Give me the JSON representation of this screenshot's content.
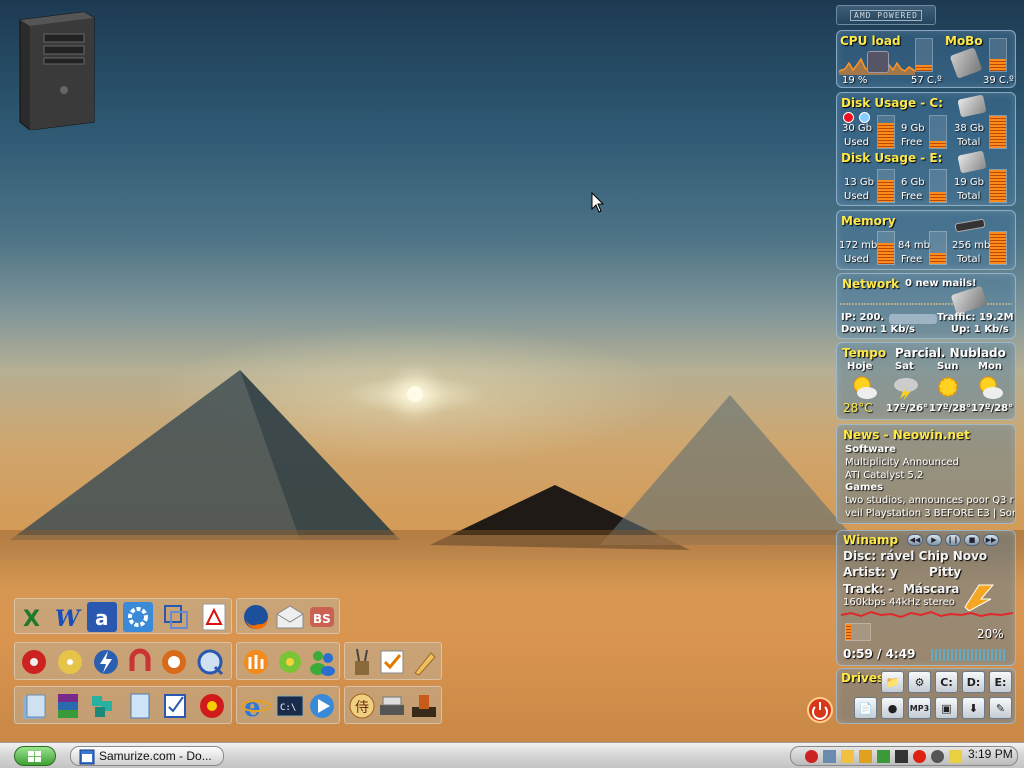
{
  "amd": {
    "label": "AMD POWERED"
  },
  "cpu": {
    "title": "CPU load",
    "load": "19 %",
    "temp": "57 C.º",
    "load_fraction": 0.19
  },
  "mobo": {
    "title": "MoBo",
    "temp": "39 C.º",
    "fraction": 0.39
  },
  "disk_c": {
    "title": "Disk Usage - C:",
    "used": "30 Gb",
    "used_label": "Used",
    "free": "9 Gb",
    "free_label": "Free",
    "total": "38 Gb",
    "total_label": "Total",
    "used_fraction": 0.79,
    "free_fraction": 0.21
  },
  "disk_e": {
    "title": "Disk Usage - E:",
    "used": "13 Gb",
    "used_label": "Used",
    "free": "6 Gb",
    "free_label": "Free",
    "total": "19 Gb",
    "total_label": "Total",
    "used_fraction": 0.68,
    "free_fraction": 0.32
  },
  "memory": {
    "title": "Memory",
    "used": "172 mb",
    "used_label": "Used",
    "free": "84 mb",
    "free_label": "Free",
    "total": "256 mb",
    "total_label": "Total",
    "used_fraction": 0.67,
    "free_fraction": 0.33
  },
  "network": {
    "title": "Network",
    "mails": "0 new mails!",
    "ip_label": "IP: 200.",
    "traffic": "Traffic: 19.2M",
    "down": "Down: 1 Kb/s",
    "up": "Up: 1 Kb/s"
  },
  "weather": {
    "title": "Tempo",
    "condition": "Parcial. Nublado",
    "days": [
      {
        "name": "Hoje",
        "temp": "28°C",
        "icon": "sun-cloud-icon"
      },
      {
        "name": "Sat",
        "temp": "17º/26°",
        "icon": "storm-cloud-icon"
      },
      {
        "name": "Sun",
        "temp": "17º/28°",
        "icon": "sun-icon"
      },
      {
        "name": "Mon",
        "temp": "17º/28°",
        "icon": "sun-cloud-icon"
      }
    ]
  },
  "news": {
    "title": "News - Neowin.net",
    "lines": [
      {
        "text": "Software",
        "bold": true
      },
      {
        "text": "Multiplicity Announced",
        "bold": false
      },
      {
        "text": "ATI Catalyst 5.2",
        "bold": false
      },
      {
        "text": "Games",
        "bold": true
      },
      {
        "text": "two studios, announces poor Q3 r",
        "bold": false
      },
      {
        "text": "veil Playstation 3 BEFORE E3 | Sor",
        "bold": false
      }
    ]
  },
  "winamp": {
    "title": "Winamp",
    "disc": "Disc: rável Chip Novo",
    "artist": "Artist: y",
    "artist_name": "Pitty",
    "track": "Track: -",
    "track_name": "Máscara",
    "bitrate": "160kbps 44kHz stereo",
    "volume": "20%",
    "time": "0:59  /  4:49",
    "volume_fraction": 0.2
  },
  "drives": {
    "title": "Drives",
    "row1": [
      "",
      "",
      "C:",
      "D:",
      "E:"
    ],
    "row2": [
      "",
      "",
      "MP3",
      "",
      "",
      ""
    ]
  },
  "taskbar": {
    "task_label": "Samurize.com - Do...",
    "clock": "3:19 PM"
  },
  "colors": {
    "accent_yellow": "#ffe84a",
    "bar_orange": "#ff8a1c",
    "panel_blue": "#46789f"
  }
}
